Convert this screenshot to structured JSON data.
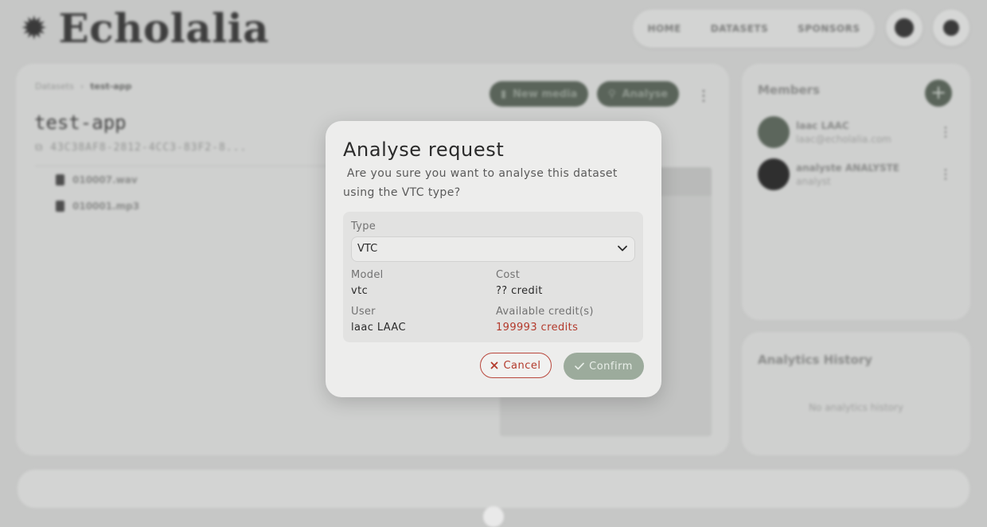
{
  "app": {
    "logo_text": "Echolalia",
    "nav": [
      "HOME",
      "DATASETS",
      "SPONSORS"
    ]
  },
  "dataset": {
    "breadcrumb": [
      "Datasets",
      "test-app"
    ],
    "title": "test-app",
    "id": "43C38AF8-2812-4CC3-83F2-8...",
    "new_media_label": "New media",
    "analyse_label": "Analyse",
    "files": [
      "010007.wav",
      "010001.mp3"
    ]
  },
  "members": {
    "title": "Members",
    "items": [
      {
        "name": "laac LAAC",
        "sub": "laac@echolalia.com"
      },
      {
        "name": "analyste ANALYSTE",
        "sub": "analyst"
      }
    ]
  },
  "history": {
    "title": "Analytics History",
    "empty": "No analytics history"
  },
  "modal": {
    "title": "Analyse request",
    "message": " Are you sure you want to analyse this dataset using the VTC type?",
    "type_label": "Type",
    "type_value": "VTC",
    "model_label": "Model",
    "model_value": "vtc",
    "cost_label": "Cost",
    "cost_value": "?? credit",
    "user_label": "User",
    "user_value": "laac LAAC",
    "available_label": "Available credit(s)",
    "available_value": "199993 credits",
    "cancel_label": "Cancel",
    "confirm_label": "Confirm"
  },
  "colors": {
    "accent": "#5a645a",
    "danger": "#b33a2c",
    "confirm_disabled": "#9cab9c"
  }
}
